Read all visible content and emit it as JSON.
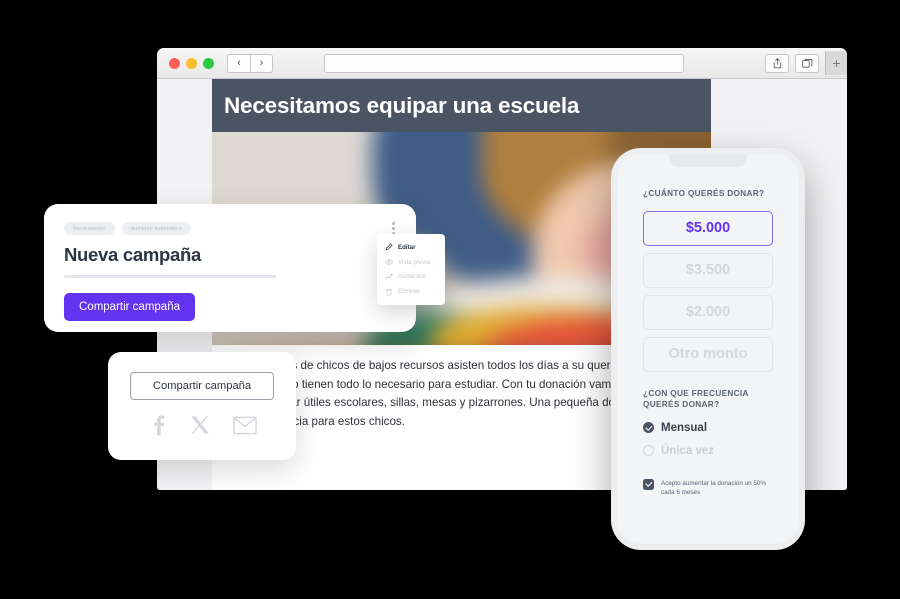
{
  "browser": {
    "traffic_lights": [
      "close",
      "minimize",
      "zoom"
    ],
    "back_label": "‹",
    "forward_label": "›",
    "address_value": "",
    "address_placeholder": "",
    "share_icon": "share-icon",
    "tabs_icon": "tabs-icon",
    "new_tab_label": "+"
  },
  "page": {
    "hero_title": "Necesitamos equipar una escuela",
    "photo_alt": "blurred photo of a child writing with colored pencils",
    "body_text": "Cientos de chicos de bajos recursos asisten todos los días a su querida escuelita. Pero no tienen todo lo necesario para estudiar.  Con tu donación vamos a poder comprar útiles escolares, sillas, mesas y pizarrones. Una pequeña donación marca la diferencia para estos chicos."
  },
  "campaign_card": {
    "tags": [
      "Recaudación",
      "Aumento automático"
    ],
    "title": "Nueva campaña",
    "share_button": "Compartir campaña",
    "kebab_icon": "more-vertical-icon"
  },
  "context_menu": {
    "items": [
      {
        "label": "Editar",
        "icon": "pencil-icon",
        "active": true
      },
      {
        "label": "Vista previa",
        "icon": "eye-icon",
        "active": false
      },
      {
        "label": "Aumentos",
        "icon": "trending-up-icon",
        "active": false
      },
      {
        "label": "Eliminar",
        "icon": "trash-icon",
        "active": false
      }
    ]
  },
  "share_card": {
    "button_label": "Compartir campaña",
    "socials": [
      {
        "name": "facebook-icon",
        "label": "Facebook"
      },
      {
        "name": "x-twitter-icon",
        "label": "X"
      },
      {
        "name": "email-icon",
        "label": "Email"
      }
    ]
  },
  "phone": {
    "amount_label": "¿CUÁNTO QUERÉS DONAR?",
    "amounts": [
      {
        "label": "$5.000",
        "selected": true
      },
      {
        "label": "$3.500",
        "selected": false
      },
      {
        "label": "$2.000",
        "selected": false
      },
      {
        "label": "Otro monto",
        "selected": false
      }
    ],
    "frequency_label": "¿CON QUE FRECUENCIA QUERÉS DONAR?",
    "frequencies": [
      {
        "label": "Mensual",
        "selected": true
      },
      {
        "label": "Única vez",
        "selected": false
      }
    ],
    "consent_text": "Acepto aumentar la donación un 50% cada 6 meses",
    "consent_checked": true
  },
  "colors": {
    "accent_purple": "#6433f0",
    "hero_slate": "#4b5465",
    "page_bg": "#f2f2f4",
    "phone_bg": "#f3f4f6",
    "muted_text": "#cbcfd6"
  }
}
